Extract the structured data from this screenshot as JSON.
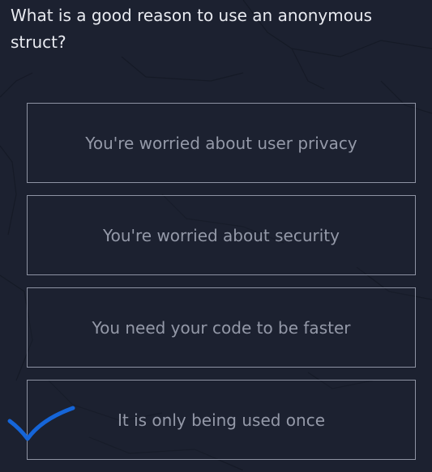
{
  "question": {
    "text": "What is a good reason to use an anonymous struct?"
  },
  "options": [
    {
      "label": "You're worried about user privacy",
      "selected": false
    },
    {
      "label": "You're worried about security",
      "selected": false
    },
    {
      "label": "You need your code to be faster",
      "selected": false
    },
    {
      "label": "It is only being used once",
      "selected": true
    }
  ],
  "checkmark": {
    "icon": "checkmark-icon",
    "color": "#1565d8"
  },
  "colors": {
    "background": "#1c2130",
    "option_border": "#8e93a3",
    "option_text": "#9499a8",
    "question_text": "#e8eaf0"
  }
}
